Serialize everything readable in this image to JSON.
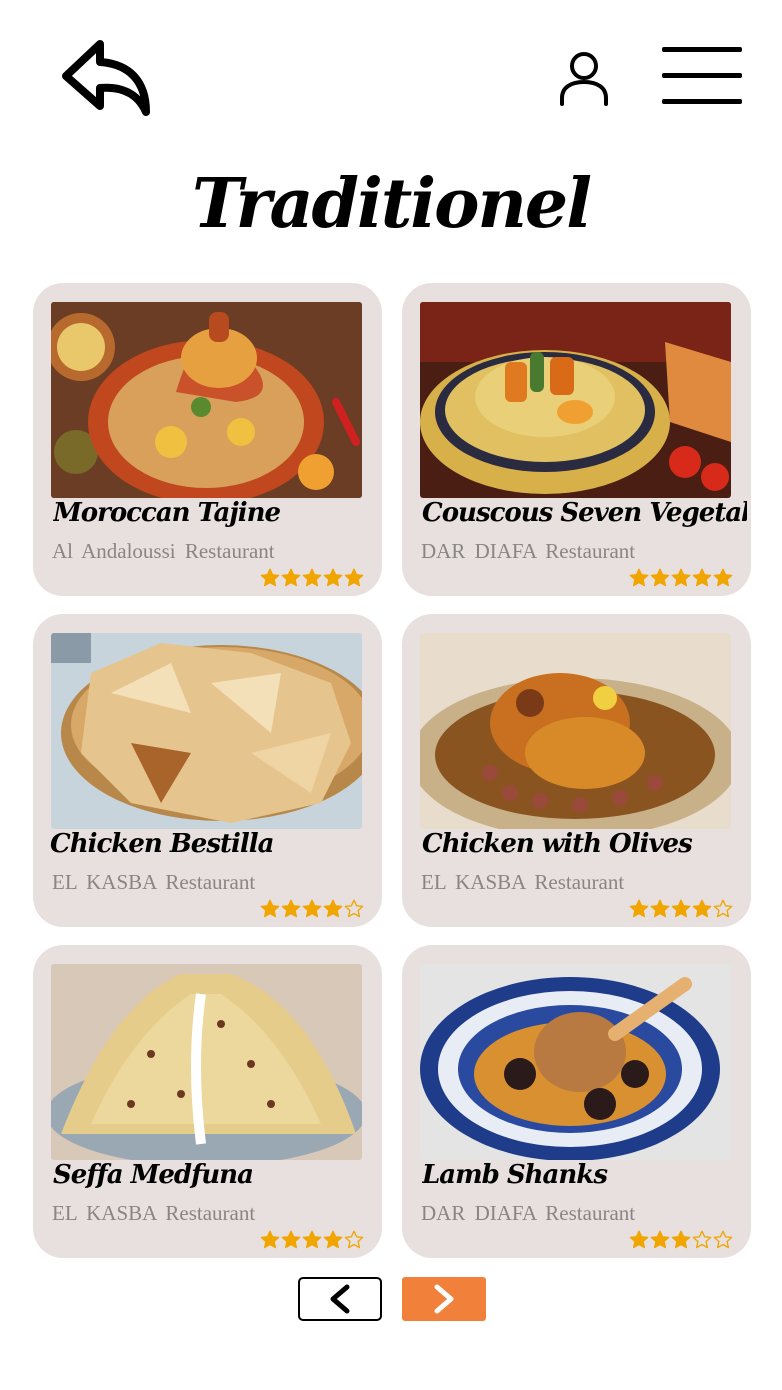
{
  "header": {
    "back_icon": "reply-arrow-icon",
    "user_icon": "user-icon",
    "menu_icon": "hamburger-menu-icon",
    "title": "Traditionel"
  },
  "dishes": [
    {
      "name": "Moroccan Tajine",
      "restaurant": "Al  Andaloussi  Restaurant",
      "rating": 5,
      "max_rating": 5,
      "image": "tajine-photo"
    },
    {
      "name": "Couscous Seven Vegetables",
      "restaurant": "DAR  DIAFA  Restaurant",
      "rating": 5,
      "max_rating": 5,
      "image": "couscous-photo"
    },
    {
      "name": "Chicken Bestilla",
      "restaurant": "EL  KASBA  Restaurant",
      "rating": 4,
      "max_rating": 5,
      "image": "bestilla-photo"
    },
    {
      "name": "Chicken with Olives",
      "restaurant": "EL  KASBA  Restaurant",
      "rating": 4,
      "max_rating": 5,
      "image": "chicken-olives-photo"
    },
    {
      "name": "Seffa Medfuna",
      "restaurant": "EL  KASBA  Restaurant",
      "rating": 4,
      "max_rating": 5,
      "image": "seffa-photo"
    },
    {
      "name": "Lamb Shanks",
      "restaurant": "DAR  DIAFA  Restaurant",
      "rating": 3,
      "max_rating": 5,
      "image": "lamb-shanks-photo"
    }
  ],
  "pagination": {
    "prev_icon": "chevron-left-icon",
    "next_icon": "chevron-right-icon"
  },
  "colors": {
    "card_bg": "#e7e0df",
    "star": "#f0a500",
    "accent": "#f0803a",
    "restaurant_text": "#8a8585"
  }
}
